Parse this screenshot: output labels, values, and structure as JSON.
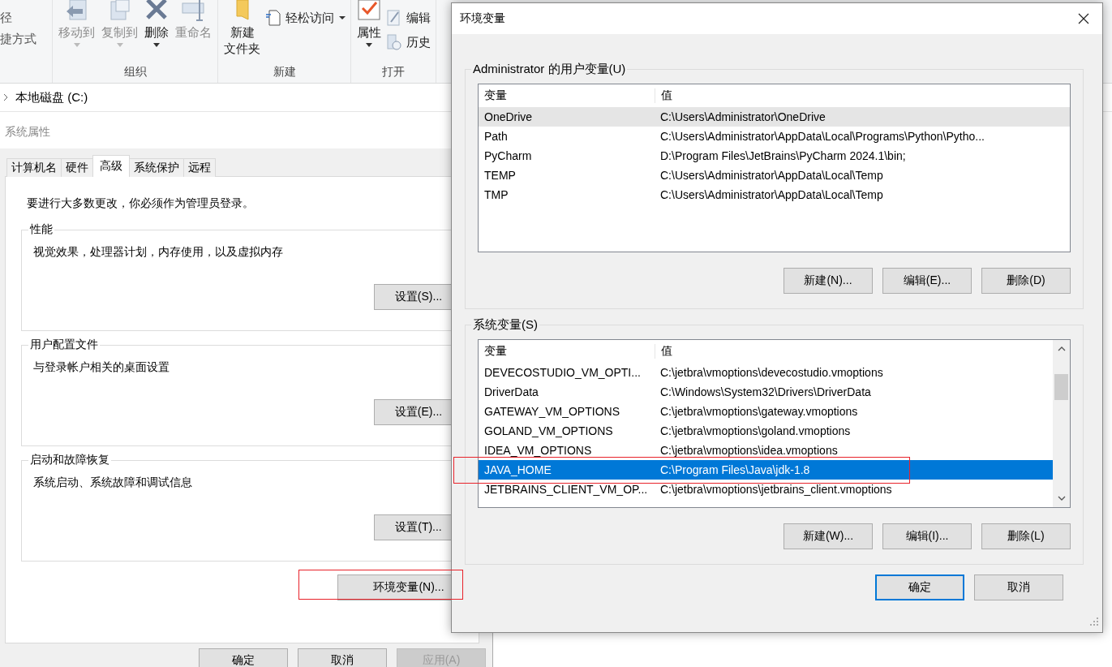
{
  "explorer": {
    "ribbon": {
      "partial_labels": [
        "径",
        "捷方式"
      ],
      "groups": [
        {
          "label": "组织",
          "large": [
            {
              "lines": [
                "移动到"
              ],
              "kind": "move",
              "disabled": true,
              "dropdown": true
            },
            {
              "lines": [
                "复制到"
              ],
              "kind": "copy",
              "disabled": true,
              "dropdown": true
            },
            {
              "lines": [
                "删除"
              ],
              "kind": "delete",
              "disabled": false,
              "dropdown": true
            },
            {
              "lines": [
                "重命名"
              ],
              "kind": "rename",
              "disabled": true,
              "dropdown": false
            }
          ]
        },
        {
          "label": "新建",
          "large": [
            {
              "lines": [
                "新建",
                "文件夹"
              ],
              "kind": "folder",
              "disabled": false,
              "dropdown": false
            }
          ],
          "small": [
            {
              "label": "轻松访问",
              "kind": "access",
              "dropdown": true
            }
          ]
        },
        {
          "label": "打开",
          "large": [
            {
              "lines": [
                "属性"
              ],
              "kind": "properties",
              "disabled": false,
              "dropdown": true
            }
          ],
          "small": [
            {
              "label": "编辑",
              "kind": "edit",
              "dropdown": false
            },
            {
              "label": "历史",
              "kind": "history",
              "dropdown": false
            }
          ]
        }
      ]
    },
    "address": {
      "crumb": "本地磁盘 (C:)"
    }
  },
  "system_properties": {
    "title": "系统属性",
    "tabs": [
      {
        "label": "计算机名",
        "selected": false
      },
      {
        "label": "硬件",
        "selected": false
      },
      {
        "label": "高级",
        "selected": true
      },
      {
        "label": "系统保护",
        "selected": false
      },
      {
        "label": "远程",
        "selected": false
      }
    ],
    "notice": "要进行大多数更改，你必须作为管理员登录。",
    "groups": [
      {
        "title": "性能",
        "description": "视觉效果，处理器计划，内存使用，以及虚拟内存",
        "button": "设置(S)..."
      },
      {
        "title": "用户配置文件",
        "description": "与登录帐户相关的桌面设置",
        "button": "设置(E)..."
      },
      {
        "title": "启动和故障恢复",
        "description": "系统启动、系统故障和调试信息",
        "button": "设置(T)..."
      }
    ],
    "env_button": "环境变量(N)...",
    "buttons": [
      {
        "label": "确定",
        "disabled": false
      },
      {
        "label": "取消",
        "disabled": false
      },
      {
        "label": "应用(A)",
        "disabled": true
      }
    ]
  },
  "environment_variables": {
    "title": "环境变量",
    "user_vars": {
      "title": "Administrator 的用户变量(U)",
      "focused": false,
      "columns": [
        "变量",
        "值"
      ],
      "rows": [
        {
          "name": "OneDrive",
          "value": "C:\\Users\\Administrator\\OneDrive",
          "selected": true
        },
        {
          "name": "Path",
          "value": "C:\\Users\\Administrator\\AppData\\Local\\Programs\\Python\\Pytho...",
          "selected": false
        },
        {
          "name": "PyCharm",
          "value": "D:\\Program Files\\JetBrains\\PyCharm 2024.1\\bin;",
          "selected": false
        },
        {
          "name": "TEMP",
          "value": "C:\\Users\\Administrator\\AppData\\Local\\Temp",
          "selected": false
        },
        {
          "name": "TMP",
          "value": "C:\\Users\\Administrator\\AppData\\Local\\Temp",
          "selected": false
        }
      ],
      "buttons": [
        "新建(N)...",
        "编辑(E)...",
        "删除(D)"
      ]
    },
    "system_vars": {
      "title": "系统变量(S)",
      "focused": true,
      "columns": [
        "变量",
        "值"
      ],
      "rows": [
        {
          "name": "DEVECOSTUDIO_VM_OPTI...",
          "value": "C:\\jetbra\\vmoptions\\devecostudio.vmoptions",
          "selected": false
        },
        {
          "name": "DriverData",
          "value": "C:\\Windows\\System32\\Drivers\\DriverData",
          "selected": false
        },
        {
          "name": "GATEWAY_VM_OPTIONS",
          "value": "C:\\jetbra\\vmoptions\\gateway.vmoptions",
          "selected": false
        },
        {
          "name": "GOLAND_VM_OPTIONS",
          "value": "C:\\jetbra\\vmoptions\\goland.vmoptions",
          "selected": false
        },
        {
          "name": "IDEA_VM_OPTIONS",
          "value": "C:\\jetbra\\vmoptions\\idea.vmoptions",
          "selected": false
        },
        {
          "name": "JAVA_HOME",
          "value": "C:\\Program Files\\Java\\jdk-1.8",
          "selected": true
        },
        {
          "name": "JETBRAINS_CLIENT_VM_OP...",
          "value": "C:\\jetbra\\vmoptions\\jetbrains_client.vmoptions",
          "selected": false
        }
      ],
      "buttons": [
        "新建(W)...",
        "编辑(I)...",
        "删除(L)"
      ]
    },
    "buttons": [
      {
        "label": "确定",
        "default": true
      },
      {
        "label": "取消",
        "default": false
      }
    ]
  }
}
